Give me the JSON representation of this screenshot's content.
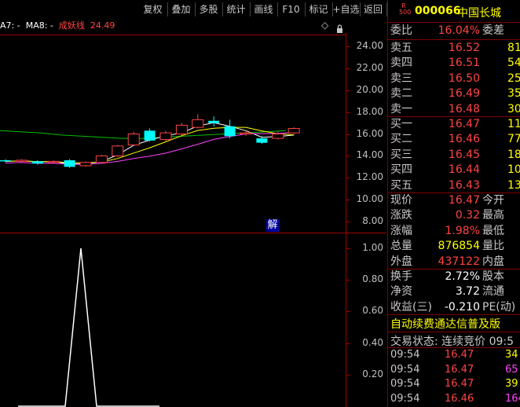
{
  "toolbar": {
    "buttons": [
      "复权",
      "叠加",
      "多股",
      "统计",
      "画线",
      "F10",
      "标记",
      "+自选",
      "返回"
    ]
  },
  "legend": {
    "ma7": "A7: -",
    "ma8": "MA8: -",
    "indicator_name": "成妖线",
    "indicator_value": "24.49",
    "diamond": "◇",
    "lock": "🔒"
  },
  "price_axis": [
    "24.00",
    "22.00",
    "20.00",
    "18.00",
    "16.00",
    "14.00",
    "12.00",
    "10.00",
    "8.00"
  ],
  "indicator_axis": [
    "1.00",
    "0.80",
    "0.60",
    "0.40",
    "0.20"
  ],
  "jie_label": "解",
  "stock": {
    "r_badge_top": "R",
    "r_badge_bottom": "500",
    "code": "000066",
    "name": "中国长城"
  },
  "weibi": {
    "label": "委比",
    "value": "16.04%",
    "label2": "委差"
  },
  "asks": [
    {
      "label": "卖五",
      "price": "16.52",
      "vol": "81"
    },
    {
      "label": "卖四",
      "price": "16.51",
      "vol": "54"
    },
    {
      "label": "卖三",
      "price": "16.50",
      "vol": "257"
    },
    {
      "label": "卖二",
      "price": "16.49",
      "vol": "35"
    },
    {
      "label": "卖一",
      "price": "16.48",
      "vol": "30"
    }
  ],
  "bids": [
    {
      "label": "买一",
      "price": "16.47",
      "vol": "119"
    },
    {
      "label": "买二",
      "price": "16.46",
      "vol": "77"
    },
    {
      "label": "买三",
      "price": "16.45",
      "vol": "189"
    },
    {
      "label": "买四",
      "price": "16.44",
      "vol": "108"
    },
    {
      "label": "买五",
      "price": "16.43",
      "vol": "137"
    }
  ],
  "quote": [
    {
      "label": "现价",
      "value": "16.47",
      "label2": "今开",
      "color": "red"
    },
    {
      "label": "涨跌",
      "value": "0.32",
      "label2": "最高",
      "color": "red"
    },
    {
      "label": "涨幅",
      "value": "1.98%",
      "label2": "最低",
      "color": "red"
    },
    {
      "label": "总量",
      "value": "876854",
      "label2": "量比",
      "color": "yellow"
    },
    {
      "label": "外盘",
      "value": "437122",
      "label2": "内盘",
      "color": "red"
    }
  ],
  "extra": [
    {
      "label": "换手",
      "value": "2.72%",
      "label2": "股本"
    },
    {
      "label": "净资",
      "value": "3.72",
      "label2": "流通"
    },
    {
      "label": "收益(三)",
      "value": "-0.210",
      "label2": "PE(动)"
    }
  ],
  "promo": "自动续费通达信普及版",
  "trade_status": "交易状态: 连续竞价 09:5",
  "ticks": [
    {
      "time": "09:54",
      "price": "16.47",
      "vol": "34",
      "vcolor": "yellow"
    },
    {
      "time": "09:54",
      "price": "16.47",
      "vol": "65",
      "vcolor": "magenta"
    },
    {
      "time": "09:54",
      "price": "16.47",
      "vol": "39",
      "vcolor": "yellow"
    },
    {
      "time": "09:54",
      "price": "16.46",
      "vol": "164",
      "vcolor": "magenta"
    }
  ],
  "colors": {
    "up": "#ff4444",
    "down": "#00ffff",
    "ma_white": "#ffffff",
    "ma_yellow": "#ffff00",
    "ma_magenta": "#ff40ff",
    "ma_green": "#00c000",
    "grid_red": "#a00000"
  },
  "chart_data": {
    "type": "candlestick",
    "title": "",
    "ylim": [
      7.0,
      25.0
    ],
    "candles": [
      {
        "o": 13.6,
        "c": 13.5,
        "h": 13.7,
        "l": 13.4
      },
      {
        "o": 13.5,
        "c": 13.6,
        "h": 13.7,
        "l": 13.4
      },
      {
        "o": 13.5,
        "c": 13.3,
        "h": 13.6,
        "l": 13.2
      },
      {
        "o": 13.4,
        "c": 13.5,
        "h": 13.6,
        "l": 13.3
      },
      {
        "o": 13.6,
        "c": 13.0,
        "h": 13.7,
        "l": 12.9
      },
      {
        "o": 13.1,
        "c": 13.4,
        "h": 13.5,
        "l": 13.0
      },
      {
        "o": 13.4,
        "c": 14.0,
        "h": 14.1,
        "l": 13.3
      },
      {
        "o": 14.0,
        "c": 14.9,
        "h": 15.0,
        "l": 13.9
      },
      {
        "o": 15.0,
        "c": 16.0,
        "h": 16.2,
        "l": 14.9
      },
      {
        "o": 16.3,
        "c": 15.4,
        "h": 16.5,
        "l": 15.3
      },
      {
        "o": 15.5,
        "c": 16.1,
        "h": 16.3,
        "l": 15.3
      },
      {
        "o": 16.0,
        "c": 16.8,
        "h": 17.0,
        "l": 15.9
      },
      {
        "o": 16.6,
        "c": 17.3,
        "h": 17.8,
        "l": 16.5
      },
      {
        "o": 17.2,
        "c": 17.0,
        "h": 17.6,
        "l": 16.7
      },
      {
        "o": 16.7,
        "c": 15.8,
        "h": 17.3,
        "l": 15.6
      },
      {
        "o": 16.0,
        "c": 16.1,
        "h": 16.3,
        "l": 15.8
      },
      {
        "o": 15.6,
        "c": 15.2,
        "h": 15.8,
        "l": 15.1
      },
      {
        "o": 15.6,
        "c": 16.0,
        "h": 16.2,
        "l": 15.5
      },
      {
        "o": 16.1,
        "c": 16.5,
        "h": 16.6,
        "l": 16.0
      }
    ],
    "ma_green": [
      16.3,
      16.2,
      16.1,
      15.9,
      15.8,
      15.7,
      15.6,
      15.6,
      15.7,
      15.8,
      15.9,
      16.0,
      16.1,
      16.2,
      16.3
    ],
    "indicator": {
      "ylim": [
        0,
        1.0
      ],
      "x": [
        0,
        1,
        2,
        3,
        4,
        5,
        6,
        7,
        8,
        9
      ],
      "values": [
        0,
        0,
        0,
        0,
        1.0,
        0,
        0,
        0,
        0,
        0
      ]
    }
  }
}
